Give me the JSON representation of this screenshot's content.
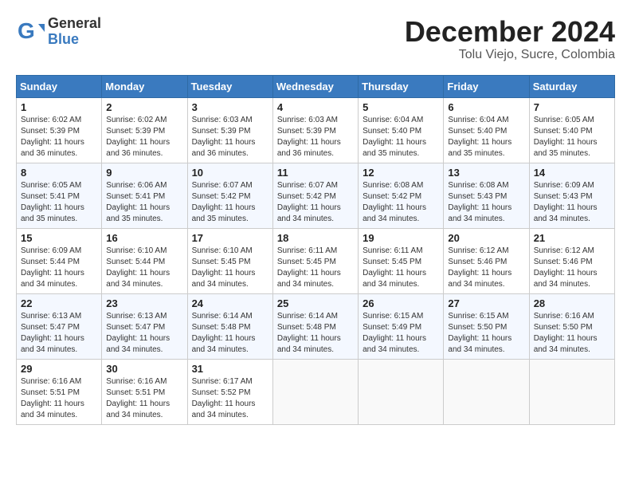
{
  "header": {
    "logo_general": "General",
    "logo_blue": "Blue",
    "month_title": "December 2024",
    "location": "Tolu Viejo, Sucre, Colombia"
  },
  "weekdays": [
    "Sunday",
    "Monday",
    "Tuesday",
    "Wednesday",
    "Thursday",
    "Friday",
    "Saturday"
  ],
  "weeks": [
    [
      {
        "day": "1",
        "sunrise": "Sunrise: 6:02 AM",
        "sunset": "Sunset: 5:39 PM",
        "daylight": "Daylight: 11 hours and 36 minutes."
      },
      {
        "day": "2",
        "sunrise": "Sunrise: 6:02 AM",
        "sunset": "Sunset: 5:39 PM",
        "daylight": "Daylight: 11 hours and 36 minutes."
      },
      {
        "day": "3",
        "sunrise": "Sunrise: 6:03 AM",
        "sunset": "Sunset: 5:39 PM",
        "daylight": "Daylight: 11 hours and 36 minutes."
      },
      {
        "day": "4",
        "sunrise": "Sunrise: 6:03 AM",
        "sunset": "Sunset: 5:39 PM",
        "daylight": "Daylight: 11 hours and 36 minutes."
      },
      {
        "day": "5",
        "sunrise": "Sunrise: 6:04 AM",
        "sunset": "Sunset: 5:40 PM",
        "daylight": "Daylight: 11 hours and 35 minutes."
      },
      {
        "day": "6",
        "sunrise": "Sunrise: 6:04 AM",
        "sunset": "Sunset: 5:40 PM",
        "daylight": "Daylight: 11 hours and 35 minutes."
      },
      {
        "day": "7",
        "sunrise": "Sunrise: 6:05 AM",
        "sunset": "Sunset: 5:40 PM",
        "daylight": "Daylight: 11 hours and 35 minutes."
      }
    ],
    [
      {
        "day": "8",
        "sunrise": "Sunrise: 6:05 AM",
        "sunset": "Sunset: 5:41 PM",
        "daylight": "Daylight: 11 hours and 35 minutes."
      },
      {
        "day": "9",
        "sunrise": "Sunrise: 6:06 AM",
        "sunset": "Sunset: 5:41 PM",
        "daylight": "Daylight: 11 hours and 35 minutes."
      },
      {
        "day": "10",
        "sunrise": "Sunrise: 6:07 AM",
        "sunset": "Sunset: 5:42 PM",
        "daylight": "Daylight: 11 hours and 35 minutes."
      },
      {
        "day": "11",
        "sunrise": "Sunrise: 6:07 AM",
        "sunset": "Sunset: 5:42 PM",
        "daylight": "Daylight: 11 hours and 34 minutes."
      },
      {
        "day": "12",
        "sunrise": "Sunrise: 6:08 AM",
        "sunset": "Sunset: 5:42 PM",
        "daylight": "Daylight: 11 hours and 34 minutes."
      },
      {
        "day": "13",
        "sunrise": "Sunrise: 6:08 AM",
        "sunset": "Sunset: 5:43 PM",
        "daylight": "Daylight: 11 hours and 34 minutes."
      },
      {
        "day": "14",
        "sunrise": "Sunrise: 6:09 AM",
        "sunset": "Sunset: 5:43 PM",
        "daylight": "Daylight: 11 hours and 34 minutes."
      }
    ],
    [
      {
        "day": "15",
        "sunrise": "Sunrise: 6:09 AM",
        "sunset": "Sunset: 5:44 PM",
        "daylight": "Daylight: 11 hours and 34 minutes."
      },
      {
        "day": "16",
        "sunrise": "Sunrise: 6:10 AM",
        "sunset": "Sunset: 5:44 PM",
        "daylight": "Daylight: 11 hours and 34 minutes."
      },
      {
        "day": "17",
        "sunrise": "Sunrise: 6:10 AM",
        "sunset": "Sunset: 5:45 PM",
        "daylight": "Daylight: 11 hours and 34 minutes."
      },
      {
        "day": "18",
        "sunrise": "Sunrise: 6:11 AM",
        "sunset": "Sunset: 5:45 PM",
        "daylight": "Daylight: 11 hours and 34 minutes."
      },
      {
        "day": "19",
        "sunrise": "Sunrise: 6:11 AM",
        "sunset": "Sunset: 5:45 PM",
        "daylight": "Daylight: 11 hours and 34 minutes."
      },
      {
        "day": "20",
        "sunrise": "Sunrise: 6:12 AM",
        "sunset": "Sunset: 5:46 PM",
        "daylight": "Daylight: 11 hours and 34 minutes."
      },
      {
        "day": "21",
        "sunrise": "Sunrise: 6:12 AM",
        "sunset": "Sunset: 5:46 PM",
        "daylight": "Daylight: 11 hours and 34 minutes."
      }
    ],
    [
      {
        "day": "22",
        "sunrise": "Sunrise: 6:13 AM",
        "sunset": "Sunset: 5:47 PM",
        "daylight": "Daylight: 11 hours and 34 minutes."
      },
      {
        "day": "23",
        "sunrise": "Sunrise: 6:13 AM",
        "sunset": "Sunset: 5:47 PM",
        "daylight": "Daylight: 11 hours and 34 minutes."
      },
      {
        "day": "24",
        "sunrise": "Sunrise: 6:14 AM",
        "sunset": "Sunset: 5:48 PM",
        "daylight": "Daylight: 11 hours and 34 minutes."
      },
      {
        "day": "25",
        "sunrise": "Sunrise: 6:14 AM",
        "sunset": "Sunset: 5:48 PM",
        "daylight": "Daylight: 11 hours and 34 minutes."
      },
      {
        "day": "26",
        "sunrise": "Sunrise: 6:15 AM",
        "sunset": "Sunset: 5:49 PM",
        "daylight": "Daylight: 11 hours and 34 minutes."
      },
      {
        "day": "27",
        "sunrise": "Sunrise: 6:15 AM",
        "sunset": "Sunset: 5:50 PM",
        "daylight": "Daylight: 11 hours and 34 minutes."
      },
      {
        "day": "28",
        "sunrise": "Sunrise: 6:16 AM",
        "sunset": "Sunset: 5:50 PM",
        "daylight": "Daylight: 11 hours and 34 minutes."
      }
    ],
    [
      {
        "day": "29",
        "sunrise": "Sunrise: 6:16 AM",
        "sunset": "Sunset: 5:51 PM",
        "daylight": "Daylight: 11 hours and 34 minutes."
      },
      {
        "day": "30",
        "sunrise": "Sunrise: 6:16 AM",
        "sunset": "Sunset: 5:51 PM",
        "daylight": "Daylight: 11 hours and 34 minutes."
      },
      {
        "day": "31",
        "sunrise": "Sunrise: 6:17 AM",
        "sunset": "Sunset: 5:52 PM",
        "daylight": "Daylight: 11 hours and 34 minutes."
      },
      null,
      null,
      null,
      null
    ]
  ]
}
